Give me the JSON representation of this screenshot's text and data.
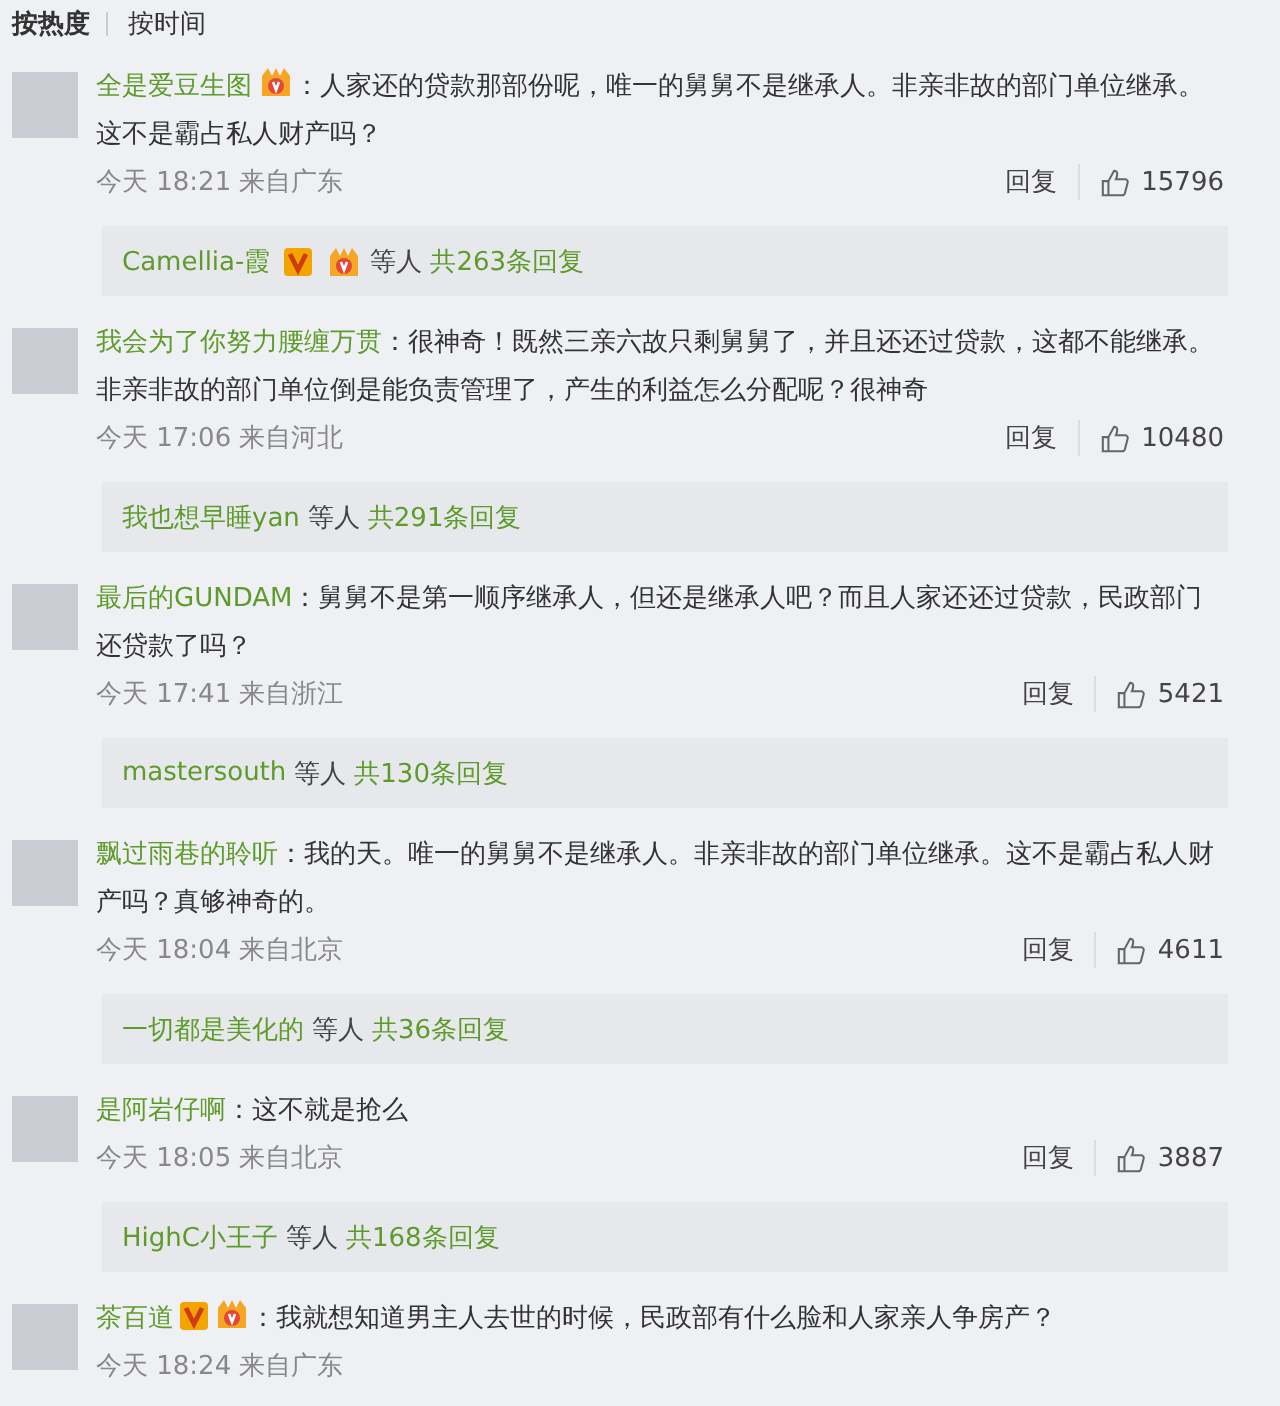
{
  "tabs": [
    {
      "label": "按热度",
      "selected": true
    },
    {
      "label": "按时间",
      "selected": false
    }
  ],
  "comments": [
    {
      "name": "全是爱豆生图",
      "verified": false,
      "vip": true,
      "text": "：人家还的贷款那部份呢，唯一的舅舅不是继承人。非亲非故的部门单位继承。这不是霸占私人财产吗？",
      "time": "今天 18:21 来自广东",
      "reply": "回复",
      "likes": "15796",
      "replies": {
        "user": "Camellia-霞",
        "verified": true,
        "vip": true,
        "others": "等人",
        "count": "共263条回复"
      }
    },
    {
      "name": "我会为了你努力腰缠万贯",
      "verified": false,
      "vip": false,
      "text": "：很神奇！既然三亲六故只剩舅舅了，并且还还过贷款，这都不能继承。非亲非故的部门单位倒是能负责管理了，产生的利益怎么分配呢？很神奇",
      "time": "今天 17:06 来自河北",
      "reply": "回复",
      "likes": "10480",
      "replies": {
        "user": "我也想早睡yan",
        "verified": false,
        "vip": false,
        "others": "等人",
        "count": "共291条回复"
      }
    },
    {
      "name": "最后的GUNDAM",
      "verified": false,
      "vip": false,
      "text": "：舅舅不是第一顺序继承人，但还是继承人吧？而且人家还还过贷款，民政部门还贷款了吗？",
      "time": "今天 17:41 来自浙江",
      "reply": "回复",
      "likes": "5421",
      "replies": {
        "user": "mastersouth",
        "verified": false,
        "vip": false,
        "others": "等人",
        "count": "共130条回复"
      }
    },
    {
      "name": "飘过雨巷的聆听",
      "verified": false,
      "vip": false,
      "text": "：我的天。唯一的舅舅不是继承人。非亲非故的部门单位继承。这不是霸占私人财产吗？真够神奇的。",
      "time": "今天 18:04 来自北京",
      "reply": "回复",
      "likes": "4611",
      "replies": {
        "user": "一切都是美化的",
        "verified": false,
        "vip": false,
        "others": "等人",
        "count": "共36条回复"
      }
    },
    {
      "name": "是阿岩仔啊",
      "verified": false,
      "vip": false,
      "text": "：这不就是抢么",
      "time": "今天 18:05 来自北京",
      "reply": "回复",
      "likes": "3887",
      "replies": {
        "user": "HighC小王子",
        "verified": false,
        "vip": false,
        "others": "等人",
        "count": "共168条回复"
      }
    },
    {
      "name": "茶百道",
      "verified": true,
      "vip": true,
      "text": "：我就想知道男主人去世的时候，民政部有什么脸和人家亲人争房产？",
      "time": "今天 18:24 来自广东"
    }
  ]
}
